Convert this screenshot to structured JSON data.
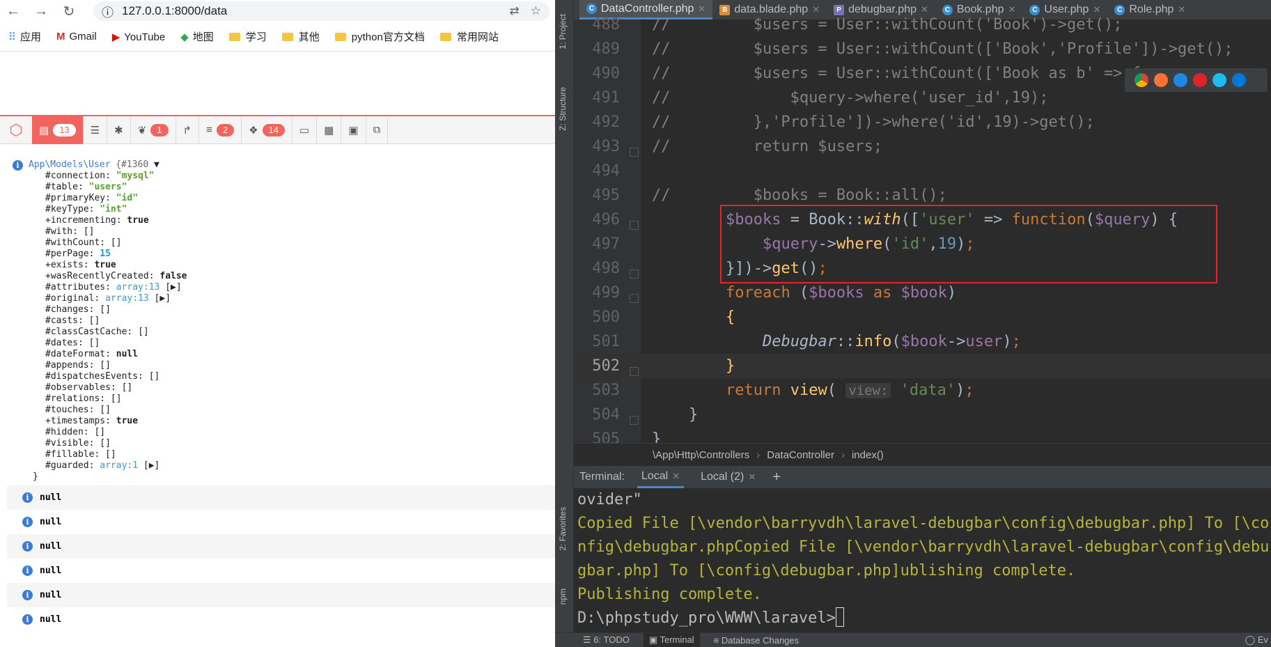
{
  "browser": {
    "url": "127.0.0.1:8000/data",
    "bookmarks": [
      {
        "label": "应用",
        "icon": "apps-grid-icon"
      },
      {
        "label": "Gmail",
        "icon": "gmail-icon"
      },
      {
        "label": "YouTube",
        "icon": "youtube-icon"
      },
      {
        "label": "地图",
        "icon": "maps-icon"
      },
      {
        "label": "学习",
        "icon": "folder-icon"
      },
      {
        "label": "其他",
        "icon": "folder-icon"
      },
      {
        "label": "python官方文档",
        "icon": "folder-icon"
      },
      {
        "label": "常用网站",
        "icon": "folder-icon"
      }
    ]
  },
  "debugbar": {
    "messages_count": "13",
    "badge_1": "1",
    "badge_2": "2",
    "badge_3": "14",
    "accent_color": "#f4645f"
  },
  "dump": {
    "class_name": "App\\Models\\User",
    "object_id": "{#1360",
    "toggle": "▼",
    "props": [
      {
        "key": "#connection: ",
        "value": "\"mysql\"",
        "type": "str"
      },
      {
        "key": "#table: ",
        "value": "\"users\"",
        "type": "str"
      },
      {
        "key": "#primaryKey: ",
        "value": "\"id\"",
        "type": "str"
      },
      {
        "key": "#keyType: ",
        "value": "\"int\"",
        "type": "str"
      },
      {
        "key": "+incrementing: ",
        "value": "true",
        "type": "kw"
      },
      {
        "key": "#with: ",
        "value": "[]",
        "type": "plain"
      },
      {
        "key": "#withCount: ",
        "value": "[]",
        "type": "plain"
      },
      {
        "key": "#perPage: ",
        "value": "15",
        "type": "num"
      },
      {
        "key": "+exists: ",
        "value": "true",
        "type": "kw"
      },
      {
        "key": "+wasRecentlyCreated: ",
        "value": "false",
        "type": "kw"
      },
      {
        "key": "#attributes: ",
        "value": "array:13",
        "type": "arr",
        "suffix": " [▶]"
      },
      {
        "key": "#original: ",
        "value": "array:13",
        "type": "arr",
        "suffix": " [▶]"
      },
      {
        "key": "#changes: ",
        "value": "[]",
        "type": "plain"
      },
      {
        "key": "#casts: ",
        "value": "[]",
        "type": "plain"
      },
      {
        "key": "#classCastCache: ",
        "value": "[]",
        "type": "plain"
      },
      {
        "key": "#dates: ",
        "value": "[]",
        "type": "plain"
      },
      {
        "key": "#dateFormat: ",
        "value": "null",
        "type": "kw"
      },
      {
        "key": "#appends: ",
        "value": "[]",
        "type": "plain"
      },
      {
        "key": "#dispatchesEvents: ",
        "value": "[]",
        "type": "plain"
      },
      {
        "key": "#observables: ",
        "value": "[]",
        "type": "plain"
      },
      {
        "key": "#relations: ",
        "value": "[]",
        "type": "plain"
      },
      {
        "key": "#touches: ",
        "value": "[]",
        "type": "plain"
      },
      {
        "key": "+timestamps: ",
        "value": "true",
        "type": "kw"
      },
      {
        "key": "#hidden: ",
        "value": "[]",
        "type": "plain"
      },
      {
        "key": "#visible: ",
        "value": "[]",
        "type": "plain"
      },
      {
        "key": "#fillable: ",
        "value": "[]",
        "type": "plain"
      },
      {
        "key": "#guarded: ",
        "value": "array:1",
        "type": "arr",
        "suffix": " [▶]"
      }
    ],
    "closing": "}",
    "null_rows": [
      "null",
      "null",
      "null",
      "null",
      "null",
      "null"
    ]
  },
  "ide": {
    "tabs": [
      {
        "label": "DataController.php",
        "icon": "C",
        "kind": "class",
        "selected": true
      },
      {
        "label": "data.blade.php",
        "icon": "B",
        "kind": "blade",
        "selected": false
      },
      {
        "label": "debugbar.php",
        "icon": "P",
        "kind": "php",
        "selected": false
      },
      {
        "label": "Book.php",
        "icon": "C",
        "kind": "class",
        "selected": false
      },
      {
        "label": "User.php",
        "icon": "C",
        "kind": "class",
        "selected": false
      },
      {
        "label": "Role.php",
        "icon": "C",
        "kind": "class",
        "selected": false
      }
    ],
    "left_tool_labels": [
      "1: Project",
      "Z: Structure",
      "2: Favorites",
      "npm"
    ],
    "breadcrumbs": [
      "\\App\\Http\\Controllers",
      "DataController",
      "index()"
    ],
    "terminal": {
      "label": "Terminal:",
      "tabs": [
        "Local",
        "Local (2)"
      ],
      "add": "+",
      "lines": [
        {
          "text": "ovider\"",
          "color": "w"
        },
        {
          "text": "Copied File [\\vendor\\barryvdh\\laravel-debugbar\\config\\debugbar.php] To [\\co",
          "color": "y"
        },
        {
          "text": "nfig\\debugbar.phpCopied File [\\vendor\\barryvdh\\laravel-debugbar\\config\\debu",
          "color": "y"
        },
        {
          "text": "gbar.php] To [\\config\\debugbar.php]ublishing complete.",
          "color": "y"
        },
        {
          "text": "Publishing complete.",
          "color": "y"
        }
      ],
      "prompt": "D:\\phpstudy_pro\\WWW\\laravel>"
    },
    "statusbar": [
      "6: TODO",
      "Terminal",
      "Database Changes",
      "Ev"
    ]
  }
}
